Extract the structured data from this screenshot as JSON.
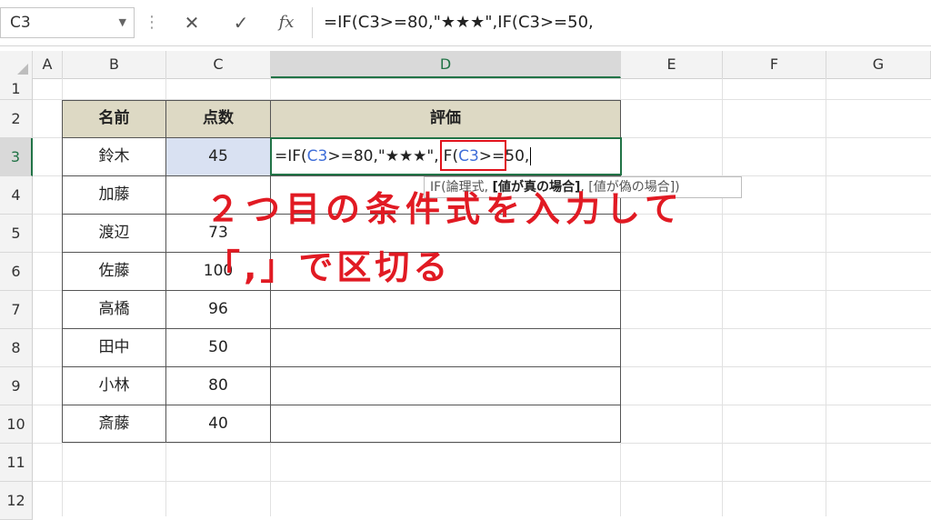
{
  "formula_bar": {
    "name_box": "C3",
    "cancel_symbol": "✕",
    "enter_symbol": "✓",
    "fx_label": "fx",
    "formula_text": "=IF(C3>=80,\"★★★\",IF(C3>=50,"
  },
  "columns": [
    "A",
    "B",
    "C",
    "D",
    "E",
    "F",
    "G"
  ],
  "rows": [
    "1",
    "2",
    "3",
    "4",
    "5",
    "6",
    "7",
    "8",
    "9",
    "10",
    "11",
    "12"
  ],
  "table": {
    "header_name": "名前",
    "header_score": "点数",
    "header_eval": "評価",
    "rows": [
      {
        "name": "鈴木",
        "score": "45"
      },
      {
        "name": "加藤",
        "score": ""
      },
      {
        "name": "渡辺",
        "score": "73"
      },
      {
        "name": "佐藤",
        "score": "100"
      },
      {
        "name": "高橋",
        "score": "96"
      },
      {
        "name": "田中",
        "score": "50"
      },
      {
        "name": "小林",
        "score": "80"
      },
      {
        "name": "斎藤",
        "score": "40"
      }
    ]
  },
  "edit_cell": {
    "part1": "=IF(",
    "ref1": "C3",
    "part2": ">=80,\"★★★\",IF(",
    "ref2": "C3",
    "part3": ">=50,"
  },
  "tooltip": {
    "part1": "IF(論理式, ",
    "bold": "[値が真の場合]",
    "part2": ", [値が偽の場合])"
  },
  "annotation": {
    "line1": "２つ目の条件式を入力して",
    "line2": "「,」で区切る"
  },
  "colors": {
    "header_fill": "#ddd9c4",
    "selected_fill": "#d9e1f2",
    "annotation_red": "#e11a23",
    "excel_green": "#217346"
  }
}
